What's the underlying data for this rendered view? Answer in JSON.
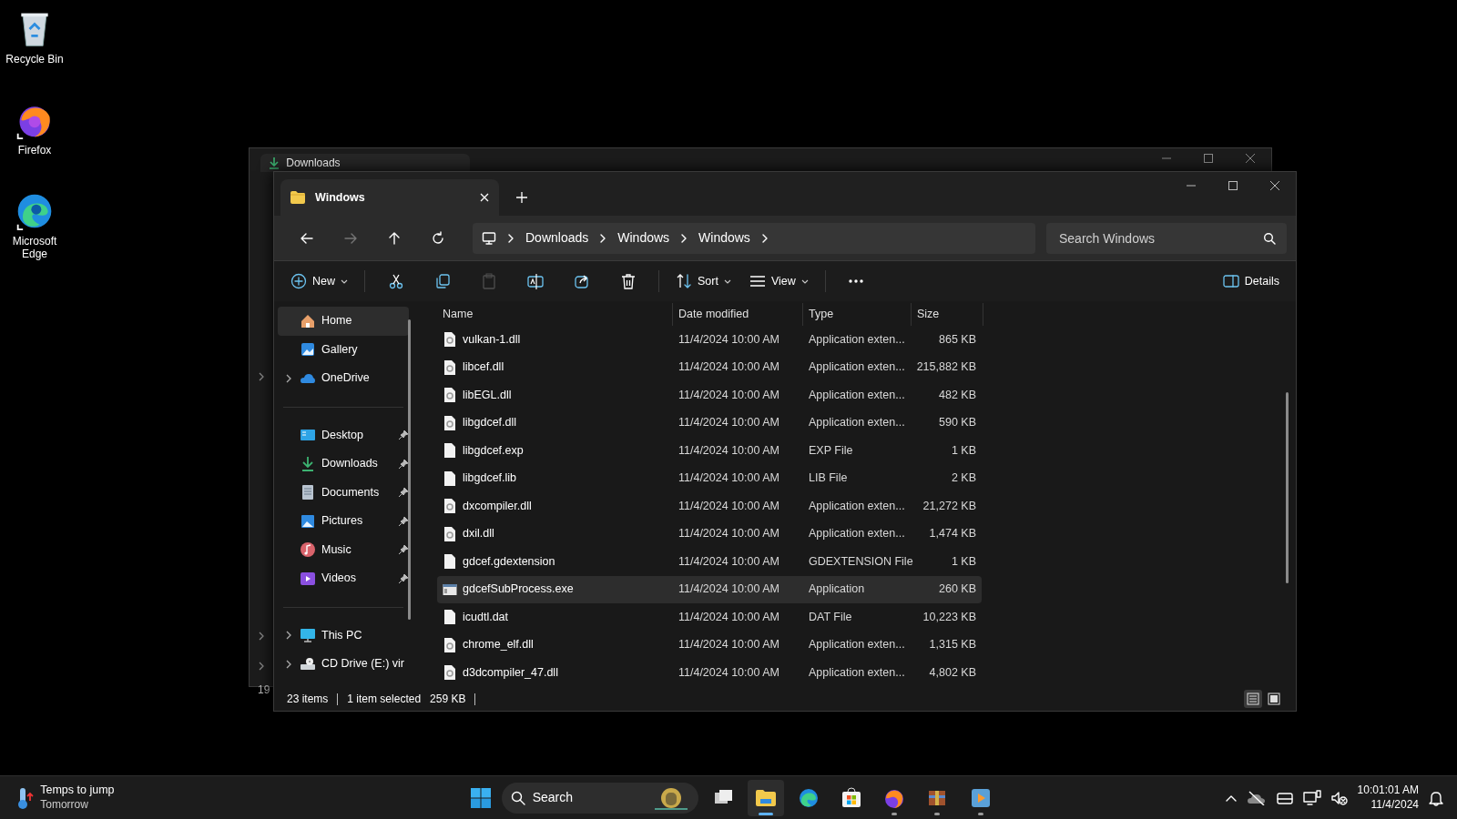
{
  "desktop_icons": [
    {
      "label": "Recycle Bin"
    },
    {
      "label": "Firefox"
    },
    {
      "label": "Microsoft Edge"
    }
  ],
  "back_window": {
    "tab": {
      "label": "Downloads"
    },
    "status_fragment": "19"
  },
  "window": {
    "tabs": [
      {
        "label": "Windows",
        "selected": true
      }
    ],
    "nav": [
      {
        "kind": "back",
        "disabled": false
      },
      {
        "kind": "forward",
        "disabled": true
      },
      {
        "kind": "up",
        "disabled": false
      },
      {
        "kind": "refresh",
        "disabled": false
      }
    ],
    "breadcrumb": [
      "Downloads",
      "Windows",
      "Windows"
    ],
    "search": {
      "placeholder": "Search Windows"
    },
    "toolbar": [
      {
        "kind": "new",
        "label": "New",
        "disabled": false
      },
      {
        "kind": "cut",
        "disabled": false
      },
      {
        "kind": "copy",
        "disabled": false
      },
      {
        "kind": "paste",
        "disabled": true
      },
      {
        "kind": "rename",
        "disabled": false
      },
      {
        "kind": "share",
        "disabled": false
      },
      {
        "kind": "delete",
        "disabled": false
      },
      {
        "kind": "sort",
        "label": "Sort",
        "disabled": false
      },
      {
        "kind": "view",
        "label": "View",
        "disabled": false
      },
      {
        "kind": "more",
        "disabled": false
      }
    ],
    "details_button": {
      "label": "Details"
    },
    "sidebar": {
      "groups": [
        {
          "items": [
            {
              "label": "Home",
              "selected": true,
              "pinned": false,
              "expandable": false
            },
            {
              "label": "Gallery",
              "selected": false,
              "pinned": false,
              "expandable": false
            },
            {
              "label": "OneDrive",
              "selected": false,
              "pinned": false,
              "expandable": true
            }
          ]
        },
        {
          "items": [
            {
              "label": "Desktop",
              "selected": false,
              "pinned": true,
              "expandable": false
            },
            {
              "label": "Downloads",
              "selected": false,
              "pinned": true,
              "expandable": false
            },
            {
              "label": "Documents",
              "selected": false,
              "pinned": true,
              "expandable": false
            },
            {
              "label": "Pictures",
              "selected": false,
              "pinned": true,
              "expandable": false
            },
            {
              "label": "Music",
              "selected": false,
              "pinned": true,
              "expandable": false
            },
            {
              "label": "Videos",
              "selected": false,
              "pinned": true,
              "expandable": false
            }
          ]
        },
        {
          "items": [
            {
              "label": "This PC",
              "selected": false,
              "pinned": false,
              "expandable": true
            },
            {
              "label": "CD Drive (E:) vir",
              "selected": false,
              "pinned": false,
              "expandable": true
            }
          ]
        }
      ]
    },
    "table": {
      "columns": [
        "Name",
        "Date modified",
        "Type",
        "Size"
      ],
      "rows": [
        {
          "name": "vulkan-1.dll",
          "kind": "dll",
          "date": "11/4/2024 10:00 AM",
          "type": "Application exten...",
          "size": "865 KB",
          "selected": false
        },
        {
          "name": "libcef.dll",
          "kind": "dll",
          "date": "11/4/2024 10:00 AM",
          "type": "Application exten...",
          "size": "215,882 KB",
          "selected": false
        },
        {
          "name": "libEGL.dll",
          "kind": "dll",
          "date": "11/4/2024 10:00 AM",
          "type": "Application exten...",
          "size": "482 KB",
          "selected": false
        },
        {
          "name": "libgdcef.dll",
          "kind": "dll",
          "date": "11/4/2024 10:00 AM",
          "type": "Application exten...",
          "size": "590 KB",
          "selected": false
        },
        {
          "name": "libgdcef.exp",
          "kind": "plain",
          "date": "11/4/2024 10:00 AM",
          "type": "EXP File",
          "size": "1 KB",
          "selected": false
        },
        {
          "name": "libgdcef.lib",
          "kind": "plain",
          "date": "11/4/2024 10:00 AM",
          "type": "LIB File",
          "size": "2 KB",
          "selected": false
        },
        {
          "name": "dxcompiler.dll",
          "kind": "dll",
          "date": "11/4/2024 10:00 AM",
          "type": "Application exten...",
          "size": "21,272 KB",
          "selected": false
        },
        {
          "name": "dxil.dll",
          "kind": "dll",
          "date": "11/4/2024 10:00 AM",
          "type": "Application exten...",
          "size": "1,474 KB",
          "selected": false
        },
        {
          "name": "gdcef.gdextension",
          "kind": "plain",
          "date": "11/4/2024 10:00 AM",
          "type": "GDEXTENSION File",
          "size": "1 KB",
          "selected": false
        },
        {
          "name": "gdcefSubProcess.exe",
          "kind": "exe",
          "date": "11/4/2024 10:00 AM",
          "type": "Application",
          "size": "260 KB",
          "selected": true
        },
        {
          "name": "icudtl.dat",
          "kind": "plain",
          "date": "11/4/2024 10:00 AM",
          "type": "DAT File",
          "size": "10,223 KB",
          "selected": false
        },
        {
          "name": "chrome_elf.dll",
          "kind": "dll",
          "date": "11/4/2024 10:00 AM",
          "type": "Application exten...",
          "size": "1,315 KB",
          "selected": false
        },
        {
          "name": "d3dcompiler_47.dll",
          "kind": "dll",
          "date": "11/4/2024 10:00 AM",
          "type": "Application exten...",
          "size": "4,802 KB",
          "selected": false
        }
      ]
    },
    "status_bar": {
      "item_count": "23 items",
      "selection": "1 item selected",
      "selection_size": "259 KB",
      "view_modes": [
        {
          "kind": "details",
          "selected": true
        },
        {
          "kind": "tiles",
          "selected": false
        }
      ]
    }
  },
  "taskbar": {
    "weather": {
      "title": "Temps to jump",
      "subtitle": "Tomorrow"
    },
    "search": {
      "placeholder": "Search"
    },
    "apps": [
      {
        "running": false,
        "active": false
      },
      {
        "running": true,
        "active": true
      },
      {
        "running": false,
        "active": false
      },
      {
        "running": false,
        "active": false
      },
      {
        "running": true,
        "active": false
      },
      {
        "running": true,
        "active": false
      },
      {
        "running": true,
        "active": false
      }
    ],
    "clock": {
      "time": "10:01:01 AM",
      "date": "11/4/2024"
    }
  }
}
